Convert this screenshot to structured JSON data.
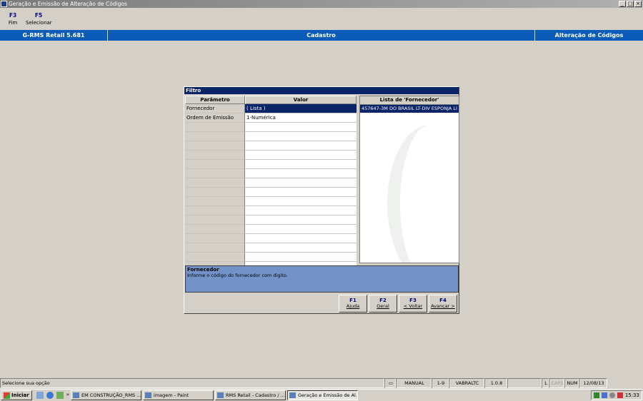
{
  "window": {
    "title": "Geração e Emissão de Alteração de Códigos"
  },
  "fkeys": [
    {
      "key": "F3",
      "label": "Fim"
    },
    {
      "key": "F5",
      "label": "Selecionar"
    }
  ],
  "modulebar": {
    "product": "G-RMS Retail 5.681",
    "module": "Cadastro",
    "screen": "Alteração de Códigos"
  },
  "dialog": {
    "title": "Filtro",
    "headers": {
      "param": "Parâmetro",
      "value": "Valor"
    },
    "rows": [
      {
        "param": "Fornecedor",
        "value": "( Lista )"
      },
      {
        "param": "Ordem de Emissão",
        "value": "1-Numérica"
      }
    ],
    "list": {
      "header": "Lista de 'Fornecedor'",
      "items": [
        "457647-3M DO BRASIL LT-DIV ESPONJA LI"
      ]
    },
    "help": {
      "title": "Fornecedor",
      "desc": "Informe o código do fornecedor com digito."
    },
    "buttons": [
      {
        "key": "F1",
        "label": "Ajuda"
      },
      {
        "key": "F2",
        "label": "Geral"
      },
      {
        "key": "F3",
        "label": "< Voltar"
      },
      {
        "key": "F4",
        "label": "Avançar >"
      }
    ]
  },
  "status": {
    "message": "Selecione sua opção",
    "mode": "MANUAL",
    "range": "1-9",
    "program": "VABRALTC",
    "version": "1.0.8",
    "l": "L",
    "caps": "CAPS",
    "num": "NUM",
    "date": "12/08/13"
  },
  "taskbar": {
    "start": "Iniciar",
    "tasks": [
      "EM CONSTRUÇÃO_RMS ...",
      "imagem - Paint",
      "RMS Retail - Cadastro / ...",
      "Geração e Emissão de Al..."
    ],
    "clock": "15:33"
  },
  "colors": {
    "module_blue": "#0a5cb8",
    "selection": "#0a246a",
    "help_bg": "#7393c8"
  }
}
